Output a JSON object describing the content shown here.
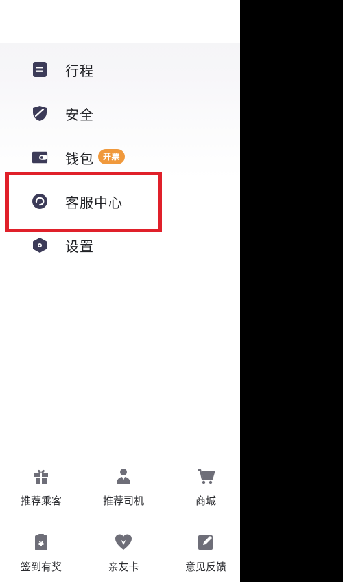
{
  "menu": {
    "items": [
      {
        "label": "行程",
        "icon": "trip-list-icon"
      },
      {
        "label": "安全",
        "icon": "shield-icon"
      },
      {
        "label": "钱包",
        "icon": "wallet-icon",
        "badge": "开票"
      },
      {
        "label": "客服中心",
        "icon": "customer-service-icon"
      },
      {
        "label": "设置",
        "icon": "settings-gear-icon"
      }
    ]
  },
  "shortcuts": {
    "row1": [
      {
        "label": "推荐乘客",
        "icon": "gift-icon"
      },
      {
        "label": "推荐司机",
        "icon": "driver-person-icon"
      },
      {
        "label": "商城",
        "icon": "shopping-cart-icon"
      }
    ],
    "row2": [
      {
        "label": "签到有奖",
        "icon": "checkin-reward-icon"
      },
      {
        "label": "亲友卡",
        "icon": "friends-heart-icon"
      },
      {
        "label": "意见反馈",
        "icon": "feedback-edit-icon"
      }
    ]
  },
  "colors": {
    "icon_dark": "#3c3b58",
    "badge": "#f0993c",
    "highlight_border": "#e0202a",
    "shortcut_icon": "#6e6e78"
  }
}
